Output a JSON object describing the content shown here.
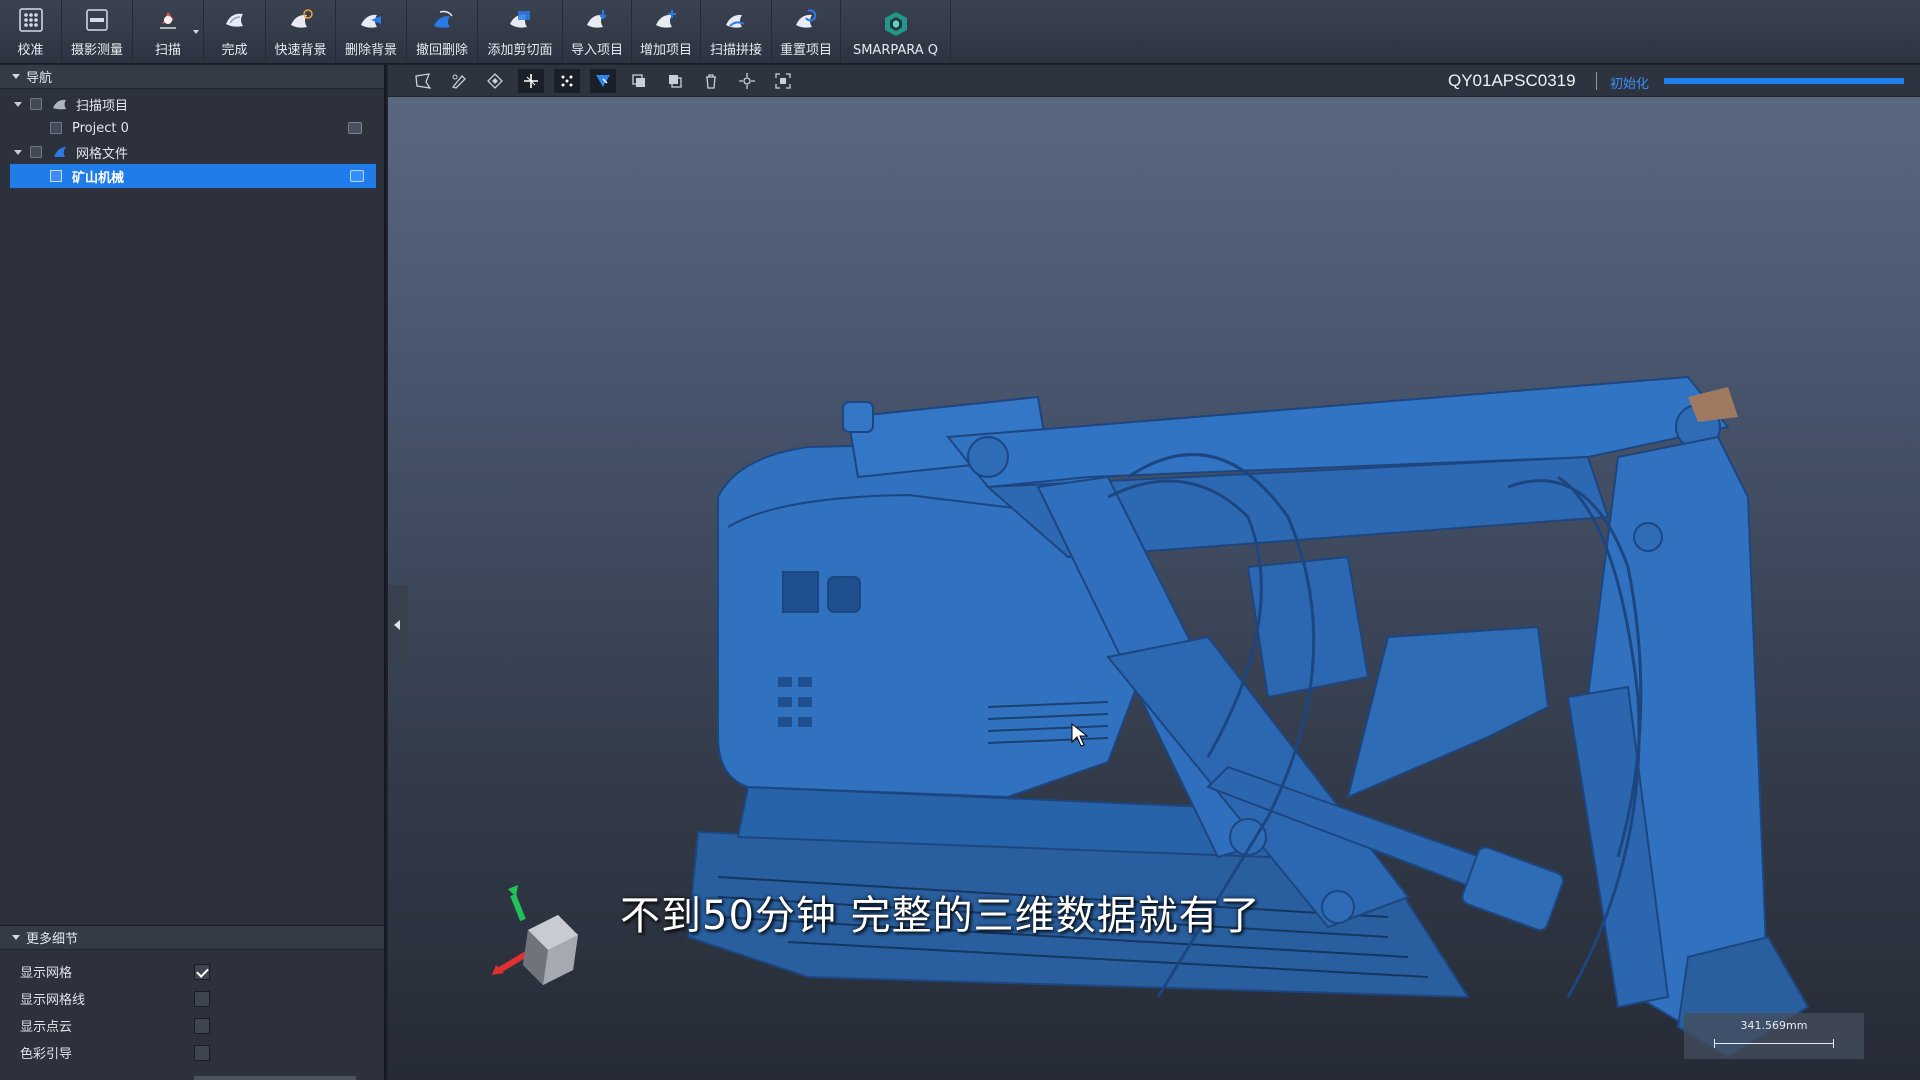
{
  "ribbon": {
    "buttons": [
      {
        "label": "校准",
        "icon": "calibration-grid-icon"
      },
      {
        "label": "摄影测量",
        "icon": "photogrammetry-icon"
      },
      {
        "label": "扫描",
        "icon": "scan-icon"
      },
      {
        "label": "完成",
        "icon": "finish-icon"
      },
      {
        "label": "快速背景",
        "icon": "quick-background-icon"
      },
      {
        "label": "删除背景",
        "icon": "delete-background-icon"
      },
      {
        "label": "撤回删除",
        "icon": "undo-delete-icon"
      },
      {
        "label": "添加剪切面",
        "icon": "add-clipping-plane-icon"
      },
      {
        "label": "导入项目",
        "icon": "import-project-icon"
      },
      {
        "label": "增加项目",
        "icon": "add-project-icon"
      },
      {
        "label": "扫描拼接",
        "icon": "scan-stitch-icon"
      },
      {
        "label": "重置项目",
        "icon": "reset-project-icon"
      },
      {
        "label": "SMARPARA Q",
        "icon": "smarpara-logo-icon"
      }
    ]
  },
  "navigation": {
    "title": "导航",
    "tree": [
      {
        "label": "扫描项目",
        "icon": "scan-project-icon"
      },
      {
        "label": "Project 0"
      },
      {
        "label": "网格文件",
        "icon": "mesh-file-icon"
      },
      {
        "label": "矿山机械",
        "selected": true
      }
    ]
  },
  "details": {
    "title": "更多细节",
    "options": [
      {
        "label": "显示网格",
        "checked": true
      },
      {
        "label": "显示网格线",
        "checked": false
      },
      {
        "label": "显示点云",
        "checked": false
      },
      {
        "label": "色彩引导",
        "checked": false
      }
    ]
  },
  "viewport": {
    "toolbar_icons": [
      "polygon-select-icon",
      "brush-select-icon",
      "eraser-icon",
      "plane-cut-icon",
      "point-select-icon",
      "view-select-icon",
      "copy-icon",
      "paste-icon",
      "delete-icon",
      "center-icon",
      "fit-view-icon"
    ],
    "device_id": "QY01APSC0319",
    "status": "初始化",
    "progress": 1.0,
    "subtitle": "不到50分钟  完整的三维数据就有了",
    "scale_label": "341.569mm",
    "model_color": "#2e6cb5"
  }
}
